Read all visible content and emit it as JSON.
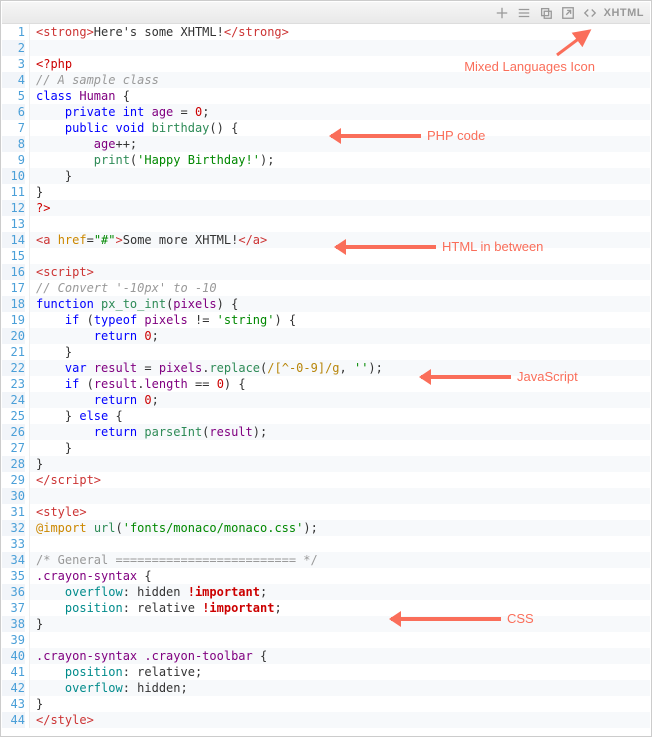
{
  "toolbar": {
    "language_label": "XHTML",
    "icons": [
      "plus-icon",
      "lines-icon",
      "copy-icon",
      "popup-icon",
      "code-icon"
    ]
  },
  "annotations": {
    "mixed": "Mixed Languages Icon",
    "php": "PHP code",
    "html": "HTML in between",
    "js": "JavaScript",
    "css": "CSS"
  },
  "lines": [
    [
      [
        "c-tag",
        "<strong>"
      ],
      [
        "c-pl",
        "Here's some XHTML!"
      ],
      [
        "c-tag",
        "</strong>"
      ]
    ],
    [],
    [
      [
        "c-phptag",
        "<?php"
      ]
    ],
    [
      [
        "c-cm",
        "// A sample class"
      ]
    ],
    [
      [
        "c-kw",
        "class "
      ],
      [
        "c-id",
        "Human"
      ],
      [
        "c-pl",
        " {"
      ]
    ],
    [
      [
        "c-pl",
        "    "
      ],
      [
        "c-kw",
        "private "
      ],
      [
        "c-kw",
        "int "
      ],
      [
        "c-var",
        "age"
      ],
      [
        "c-pl",
        " = "
      ],
      [
        "c-num",
        "0"
      ],
      [
        "c-pl",
        ";"
      ]
    ],
    [
      [
        "c-pl",
        "    "
      ],
      [
        "c-kw",
        "public "
      ],
      [
        "c-kw",
        "void "
      ],
      [
        "c-fn",
        "birthday"
      ],
      [
        "c-pl",
        "() {"
      ]
    ],
    [
      [
        "c-pl",
        "        "
      ],
      [
        "c-var",
        "age"
      ],
      [
        "c-pl",
        "++;"
      ]
    ],
    [
      [
        "c-pl",
        "        "
      ],
      [
        "c-fn",
        "print"
      ],
      [
        "c-pl",
        "("
      ],
      [
        "c-str",
        "'Happy Birthday!'"
      ],
      [
        "c-pl",
        ");"
      ]
    ],
    [
      [
        "c-pl",
        "    }"
      ]
    ],
    [
      [
        "c-pl",
        "}"
      ]
    ],
    [
      [
        "c-phptag",
        "?>"
      ]
    ],
    [],
    [
      [
        "c-tag",
        "<a "
      ],
      [
        "c-at",
        "href"
      ],
      [
        "c-pl",
        "="
      ],
      [
        "c-str",
        "\"#\""
      ],
      [
        "c-tag",
        ">"
      ],
      [
        "c-pl",
        "Some more XHTML!"
      ],
      [
        "c-tag",
        "</a>"
      ]
    ],
    [],
    [
      [
        "c-tag",
        "<script>"
      ]
    ],
    [
      [
        "c-cm",
        "// Convert '-10px' to -10"
      ]
    ],
    [
      [
        "c-kw",
        "function "
      ],
      [
        "c-fn",
        "px_to_int"
      ],
      [
        "c-pl",
        "("
      ],
      [
        "c-var",
        "pixels"
      ],
      [
        "c-pl",
        ") {"
      ]
    ],
    [
      [
        "c-pl",
        "    "
      ],
      [
        "c-kw",
        "if "
      ],
      [
        "c-pl",
        "("
      ],
      [
        "c-kw",
        "typeof "
      ],
      [
        "c-var",
        "pixels"
      ],
      [
        "c-pl",
        " != "
      ],
      [
        "c-str",
        "'string'"
      ],
      [
        "c-pl",
        ") {"
      ]
    ],
    [
      [
        "c-pl",
        "        "
      ],
      [
        "c-kw",
        "return "
      ],
      [
        "c-num",
        "0"
      ],
      [
        "c-pl",
        ";"
      ]
    ],
    [
      [
        "c-pl",
        "    }"
      ]
    ],
    [
      [
        "c-pl",
        "    "
      ],
      [
        "c-kw",
        "var "
      ],
      [
        "c-var",
        "result"
      ],
      [
        "c-pl",
        " = "
      ],
      [
        "c-var",
        "pixels"
      ],
      [
        "c-pl",
        "."
      ],
      [
        "c-fn",
        "replace"
      ],
      [
        "c-pl",
        "("
      ],
      [
        "c-regex",
        "/[^-0-9]/g"
      ],
      [
        "c-pl",
        ", "
      ],
      [
        "c-str",
        "''"
      ],
      [
        "c-pl",
        ");"
      ]
    ],
    [
      [
        "c-pl",
        "    "
      ],
      [
        "c-kw",
        "if "
      ],
      [
        "c-pl",
        "("
      ],
      [
        "c-var",
        "result"
      ],
      [
        "c-pl",
        "."
      ],
      [
        "c-var",
        "length"
      ],
      [
        "c-pl",
        " == "
      ],
      [
        "c-num",
        "0"
      ],
      [
        "c-pl",
        ") {"
      ]
    ],
    [
      [
        "c-pl",
        "        "
      ],
      [
        "c-kw",
        "return "
      ],
      [
        "c-num",
        "0"
      ],
      [
        "c-pl",
        ";"
      ]
    ],
    [
      [
        "c-pl",
        "    } "
      ],
      [
        "c-kw",
        "else"
      ],
      [
        "c-pl",
        " {"
      ]
    ],
    [
      [
        "c-pl",
        "        "
      ],
      [
        "c-kw",
        "return "
      ],
      [
        "c-fn",
        "parseInt"
      ],
      [
        "c-pl",
        "("
      ],
      [
        "c-var",
        "result"
      ],
      [
        "c-pl",
        ");"
      ]
    ],
    [
      [
        "c-pl",
        "    }"
      ]
    ],
    [
      [
        "c-pl",
        "}"
      ]
    ],
    [
      [
        "c-tag",
        "</script>"
      ]
    ],
    [],
    [
      [
        "c-tag",
        "<style>"
      ]
    ],
    [
      [
        "c-at",
        "@import"
      ],
      [
        "c-pl",
        " "
      ],
      [
        "c-fn",
        "url"
      ],
      [
        "c-pl",
        "("
      ],
      [
        "c-str",
        "'fonts/monaco/monaco.css'"
      ],
      [
        "c-pl",
        ");"
      ]
    ],
    [],
    [
      [
        "c-cmblk",
        "/* General ========================= */"
      ]
    ],
    [
      [
        "c-sel",
        ".crayon-syntax"
      ],
      [
        "c-pl",
        " {"
      ]
    ],
    [
      [
        "c-pl",
        "    "
      ],
      [
        "c-prop",
        "overflow"
      ],
      [
        "c-pl",
        ": hidden "
      ],
      [
        "c-imp",
        "!important"
      ],
      [
        "c-pl",
        ";"
      ]
    ],
    [
      [
        "c-pl",
        "    "
      ],
      [
        "c-prop",
        "position"
      ],
      [
        "c-pl",
        ": relative "
      ],
      [
        "c-imp",
        "!important"
      ],
      [
        "c-pl",
        ";"
      ]
    ],
    [
      [
        "c-pl",
        "}"
      ]
    ],
    [],
    [
      [
        "c-sel",
        ".crayon-syntax .crayon-toolbar"
      ],
      [
        "c-pl",
        " {"
      ]
    ],
    [
      [
        "c-pl",
        "    "
      ],
      [
        "c-prop",
        "position"
      ],
      [
        "c-pl",
        ": relative;"
      ]
    ],
    [
      [
        "c-pl",
        "    "
      ],
      [
        "c-prop",
        "overflow"
      ],
      [
        "c-pl",
        ": hidden;"
      ]
    ],
    [
      [
        "c-pl",
        "}"
      ]
    ],
    [
      [
        "c-tag",
        "</style>"
      ]
    ]
  ]
}
